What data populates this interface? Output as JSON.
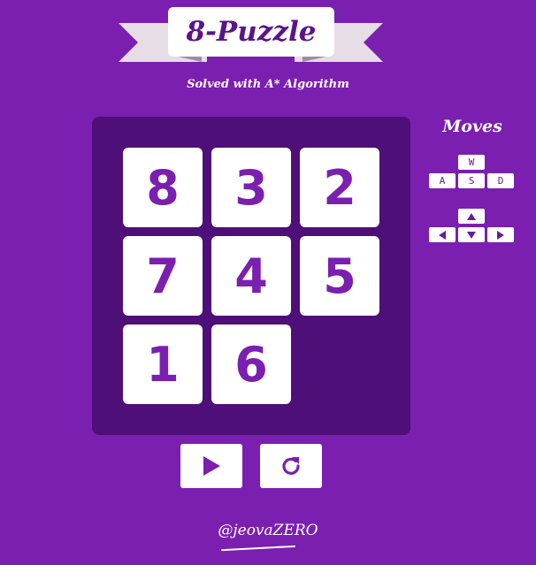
{
  "header": {
    "title": "8-Puzzle",
    "subtitle": "Solved with A* Algorithm"
  },
  "board": {
    "tiles": [
      {
        "label": "8"
      },
      {
        "label": "3"
      },
      {
        "label": "2"
      },
      {
        "label": "7"
      },
      {
        "label": "4"
      },
      {
        "label": "5"
      },
      {
        "label": "1"
      },
      {
        "label": "6"
      }
    ],
    "empty_cell": "row 3, column 3"
  },
  "controls": {
    "play_icon": "play-icon",
    "reset_icon": "refresh-icon"
  },
  "moves": {
    "label": "Moves",
    "wasd": {
      "up": "W",
      "left": "A",
      "down": "S",
      "right": "D"
    },
    "arrows": [
      "arrow-up-icon",
      "arrow-left-icon",
      "arrow-down-icon",
      "arrow-right-icon"
    ]
  },
  "footer": {
    "credit": "@jeovaZERO"
  },
  "colors": {
    "background": "#7b1fb0",
    "board": "#4f0f79",
    "tile": "#ffffff",
    "tile_text": "#7b1fb0",
    "title_text": "#5b148a"
  }
}
